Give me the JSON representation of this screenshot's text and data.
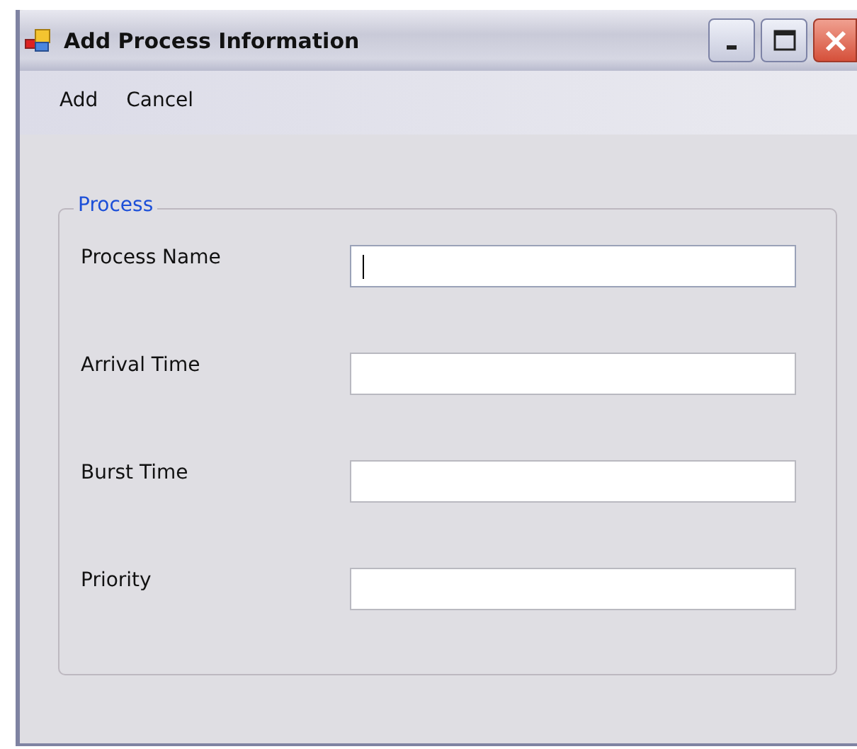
{
  "window": {
    "title": "Add Process Information"
  },
  "menu": [
    {
      "label": "Add"
    },
    {
      "label": "Cancel"
    }
  ],
  "group": {
    "title": "Process"
  },
  "fields": [
    {
      "label": "Process Name",
      "focused": true
    },
    {
      "label": "Arrival Time",
      "focused": false
    },
    {
      "label": "Burst Time",
      "focused": false
    },
    {
      "label": "Priority",
      "focused": false
    }
  ]
}
